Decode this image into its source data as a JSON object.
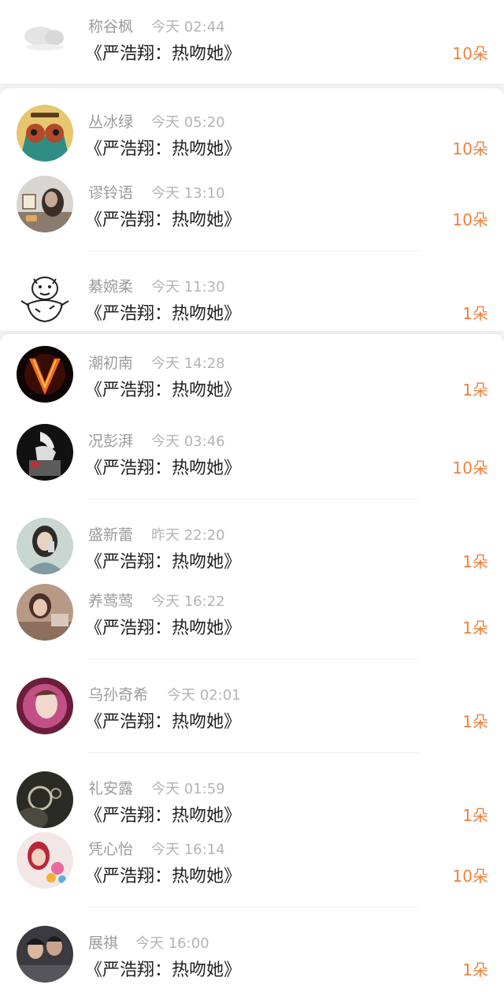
{
  "colors": {
    "accent": "#f0803c",
    "name": "#9b9b9b",
    "time": "#b4b4b4",
    "message": "#222222"
  },
  "entries": [
    {
      "name": "称谷枫",
      "time": "今天 02:44",
      "message": "《严浩翔：热吻她》",
      "gift": "10朵",
      "avatar": "blurred-avatar"
    },
    {
      "name": "丛冰绿",
      "time": "今天 05:20",
      "message": "《严浩翔：热吻她》",
      "gift": "10朵",
      "avatar": "gemini-cartoon-avatar"
    },
    {
      "name": "谬铃语",
      "time": "今天 13:10",
      "message": "《严浩翔：热吻她》",
      "gift": "10朵",
      "avatar": "girl-photo-avatar"
    },
    {
      "name": "綦婉柔",
      "time": "今天 11:30",
      "message": "《严浩翔：热吻她》",
      "gift": "1朵",
      "avatar": "tiger-sketch-avatar"
    },
    {
      "name": "潮初南",
      "time": "今天 14:28",
      "message": "《严浩翔：热吻她》",
      "gift": "1朵",
      "avatar": "fire-v-avatar"
    },
    {
      "name": "况彭湃",
      "time": "今天 03:46",
      "message": "《严浩翔：热吻她》",
      "gift": "10朵",
      "avatar": "horse-statue-avatar"
    },
    {
      "name": "盛新蕾",
      "time": "昨天 22:20",
      "message": "《严浩翔：热吻她》",
      "gift": "1朵",
      "avatar": "girl-selfie-avatar"
    },
    {
      "name": "养莺莺",
      "time": "今天 16:22",
      "message": "《严浩翔：热吻她》",
      "gift": "1朵",
      "avatar": "girl-room-avatar"
    },
    {
      "name": "乌孙奇希",
      "time": "今天 02:01",
      "message": "《严浩翔：热吻她》",
      "gift": "1朵",
      "avatar": "child-portrait-avatar"
    },
    {
      "name": "礼安露",
      "time": "今天 01:59",
      "message": "《严浩翔：热吻她》",
      "gift": "1朵",
      "avatar": "smoke-ring-avatar"
    },
    {
      "name": "凭心怡",
      "time": "今天 16:14",
      "message": "《严浩翔：热吻她》",
      "gift": "10朵",
      "avatar": "pink-girl-avatar"
    },
    {
      "name": "展祺",
      "time": "今天 16:00",
      "message": "《严浩翔：热吻她》",
      "gift": "1朵",
      "avatar": "couple-photo-avatar"
    }
  ]
}
